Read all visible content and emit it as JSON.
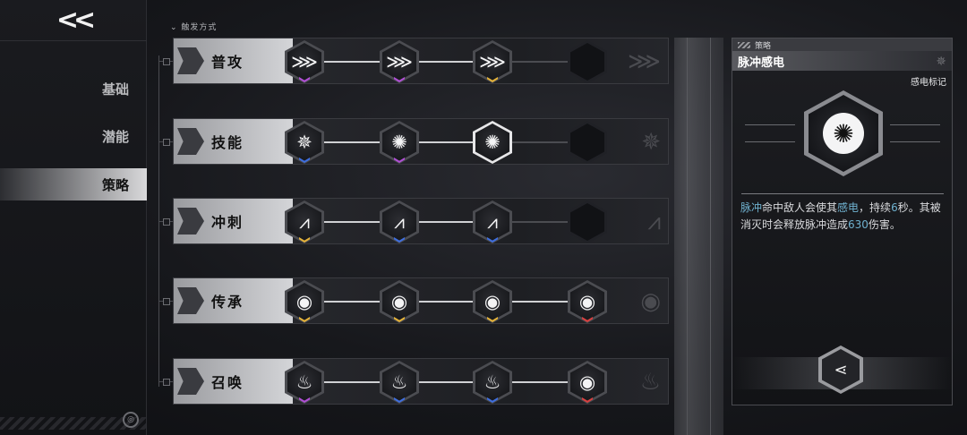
{
  "back_label": "<<",
  "sidebar": {
    "items": [
      {
        "label": "基础",
        "active": false
      },
      {
        "label": "潜能",
        "active": false
      },
      {
        "label": "策略",
        "active": true
      }
    ]
  },
  "trigger_header": "触发方式",
  "rows": [
    {
      "label": "普攻",
      "ghost_icon": "dagger-swarm-icon",
      "nodes": [
        {
          "icon": "dagger-swarm-icon",
          "glyph": "⋙",
          "tier": "purple"
        },
        {
          "icon": "dagger-swarm-up-icon",
          "glyph": "⋙",
          "tier": "purple"
        },
        {
          "icon": "dagger-swarm-x-icon",
          "glyph": "⋙",
          "tier": "gold"
        },
        {
          "icon": "empty-slot",
          "glyph": "",
          "tier": "none"
        }
      ]
    },
    {
      "label": "技能",
      "ghost_icon": "star-burst-icon",
      "nodes": [
        {
          "icon": "star-burst-icon",
          "glyph": "✵",
          "tier": "blue"
        },
        {
          "icon": "radial-burst-icon",
          "glyph": "✺",
          "tier": "purple"
        },
        {
          "icon": "pulse-shock-icon",
          "glyph": "✺",
          "tier": "none",
          "selected": true
        },
        {
          "icon": "empty-slot",
          "glyph": "",
          "tier": "none"
        }
      ]
    },
    {
      "label": "冲刺",
      "ghost_icon": "claw-icon",
      "nodes": [
        {
          "icon": "claw-icon",
          "glyph": "⩘",
          "tier": "gold"
        },
        {
          "icon": "claw-up-icon",
          "glyph": "⩘",
          "tier": "blue"
        },
        {
          "icon": "claw-x-icon",
          "glyph": "⩘",
          "tier": "blue"
        },
        {
          "icon": "empty-slot",
          "glyph": "",
          "tier": "none"
        }
      ]
    },
    {
      "label": "传承",
      "ghost_icon": "vortex-icon",
      "nodes": [
        {
          "icon": "vortex-icon",
          "glyph": "◉",
          "tier": "gold"
        },
        {
          "icon": "vortex-icon",
          "glyph": "◉",
          "tier": "gold"
        },
        {
          "icon": "vortex-icon",
          "glyph": "◉",
          "tier": "gold"
        },
        {
          "icon": "vortex-icon",
          "glyph": "◉",
          "tier": "red"
        }
      ]
    },
    {
      "label": "召唤",
      "ghost_icon": "flame-icon",
      "nodes": [
        {
          "icon": "flame-icon",
          "glyph": "♨",
          "tier": "purple"
        },
        {
          "icon": "flame-plus-icon",
          "glyph": "♨",
          "tier": "blue"
        },
        {
          "icon": "flame-x-icon",
          "glyph": "♨",
          "tier": "blue"
        },
        {
          "icon": "vortex-icon",
          "glyph": "◉",
          "tier": "red"
        }
      ]
    }
  ],
  "tier_colors": {
    "purple": "#b14fd6",
    "gold": "#e5b33a",
    "blue": "#3f6fe0",
    "red": "#d94040",
    "none": "transparent"
  },
  "panel": {
    "section": "策略",
    "title": "脉冲感电",
    "tag": "感电标记",
    "emblem_icon": "pulse-shock-icon",
    "desc_parts": [
      {
        "text": "脉冲",
        "hl": true
      },
      {
        "text": "命中敌人会使其",
        "hl": false
      },
      {
        "text": "感电",
        "hl": true
      },
      {
        "text": "，持续",
        "hl": false
      },
      {
        "text": "6",
        "hl": true
      },
      {
        "text": "秒。其被消灭时会释放脉冲造成",
        "hl": false
      },
      {
        "text": "630",
        "hl": true
      },
      {
        "text": "伤害。",
        "hl": false
      }
    ],
    "share_icon": "share-icon"
  }
}
